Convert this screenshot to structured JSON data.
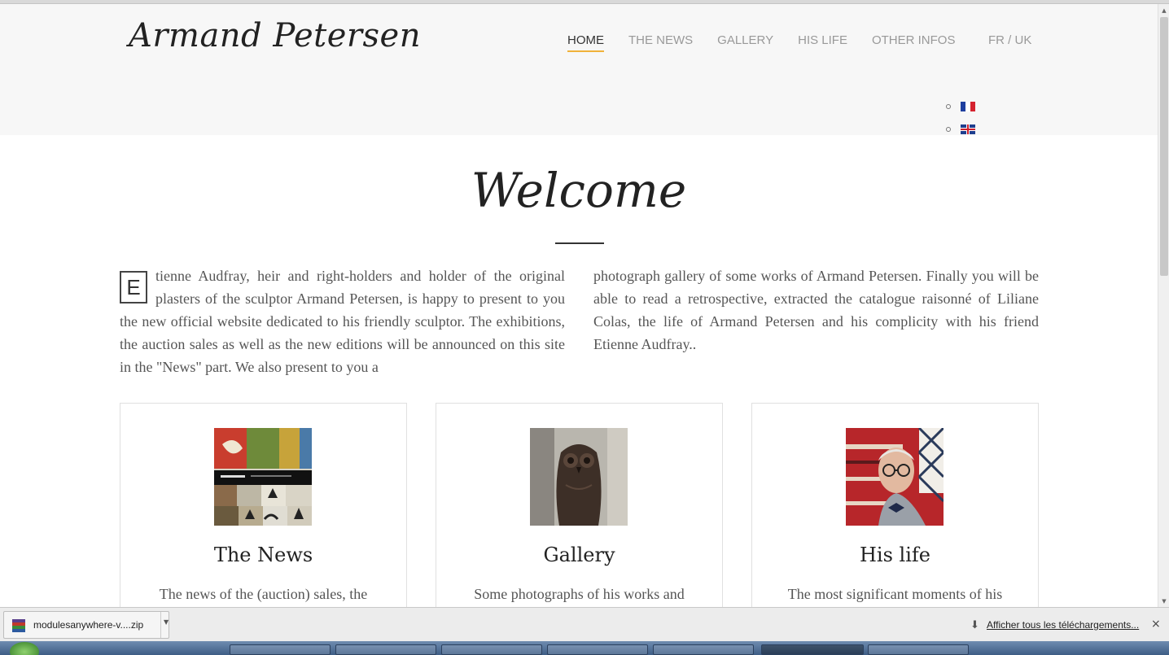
{
  "header": {
    "site_title": "Armand Petersen",
    "nav": [
      {
        "label": "HOME",
        "active": true
      },
      {
        "label": "THE NEWS",
        "active": false
      },
      {
        "label": "GALLERY",
        "active": false
      },
      {
        "label": "HIS LIFE",
        "active": false
      },
      {
        "label": "OTHER INFOS",
        "active": false
      }
    ],
    "lang_toggle": "FR / UK",
    "accent_color": "#f0b23a"
  },
  "main": {
    "heading": "Welcome",
    "dropcap": "E",
    "col_left": "tienne Audfray, heir and right-holders and holder of the original plasters of the sculptor Armand Petersen, is happy to present to you the new official website dedicated to his friendly sculptor. The exhibitions, the auction sales as well as the new editions will be announced on this site in the \"News\" part. We also present to you a",
    "col_right": "photograph gallery of some works of Armand Petersen. Finally you will be able to read a retrospective, extracted the catalogue raisonné of Liliane Colas, the life of Armand Petersen and his complicity with his friend Etienne Audfray..",
    "cards": [
      {
        "title": "The News",
        "desc": "The news of the (auction) sales, the"
      },
      {
        "title": "Gallery",
        "desc": "Some photographs of his works and"
      },
      {
        "title": "His life",
        "desc": "The most significant moments of his"
      }
    ]
  },
  "download_bar": {
    "file_name": "modulesanywhere-v....zip",
    "show_all": "Afficher tous les téléchargements...",
    "close": "×"
  }
}
